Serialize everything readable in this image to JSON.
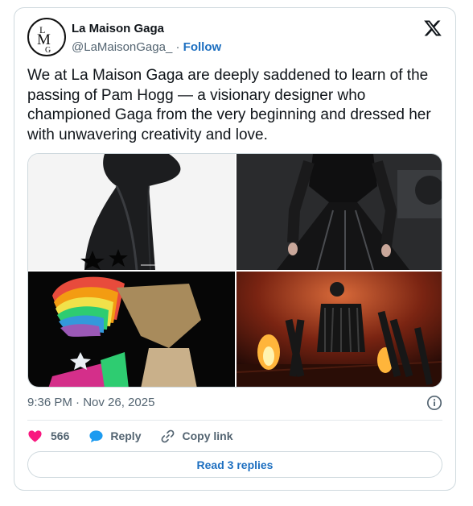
{
  "author": {
    "name": "La Maison Gaga",
    "handle": "@LaMaisonGaga_",
    "separator": "·",
    "follow_label": "Follow",
    "avatar_monogram": "LMG"
  },
  "tweet": {
    "text": "We at La Maison Gaga are deeply saddened to learn of the passing of Pam Hogg — a visionary designer who championed Gaga from the very beginning and dressed her with unwavering creativity and love.",
    "timestamp": "9:36 PM · Nov 26, 2025"
  },
  "media": [
    {
      "icon": "photo",
      "subject": "black leather glove with stars"
    },
    {
      "icon": "photo",
      "subject": "black leather dress outfit"
    },
    {
      "icon": "photo",
      "subject": "rainbow sculptural headpiece"
    },
    {
      "icon": "photo",
      "subject": "stage performance with fire"
    }
  ],
  "actions": {
    "like_count": "566",
    "reply_label": "Reply",
    "copy_link_label": "Copy link"
  },
  "read_replies_label": "Read 3 replies",
  "colors": {
    "accent": "#1d6fc0",
    "like": "#f91880",
    "reply": "#1d9bf0",
    "border": "#cfd9de",
    "secondary_text": "#536471"
  }
}
